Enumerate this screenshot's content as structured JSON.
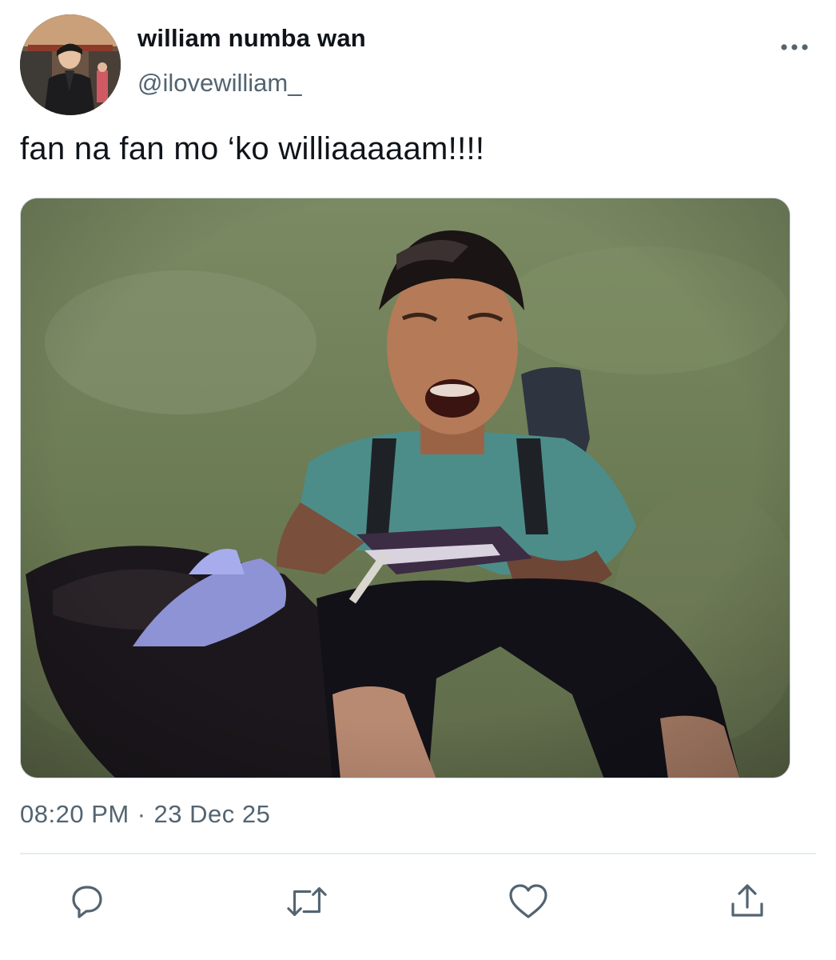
{
  "tweet": {
    "display_name": "william numba wan",
    "handle": "@ilovewilliam_",
    "text": "fan na fan mo ‘ko williaaaaam!!!!",
    "time": "08:20 PM",
    "separator": "·",
    "date": "23 Dec 25"
  },
  "avatar": {
    "description_icon": "profile-photo"
  },
  "media": {
    "icon": "embedded-photo"
  },
  "actions": {
    "reply_icon": "reply-icon",
    "retweet_icon": "retweet-icon",
    "like_icon": "heart-icon",
    "share_icon": "share-icon",
    "more_icon": "more-dots-icon"
  },
  "colors": {
    "text_primary": "#0f1419",
    "text_secondary": "#536471",
    "icon_gray": "#536471",
    "divider": "#e6ecf0"
  }
}
